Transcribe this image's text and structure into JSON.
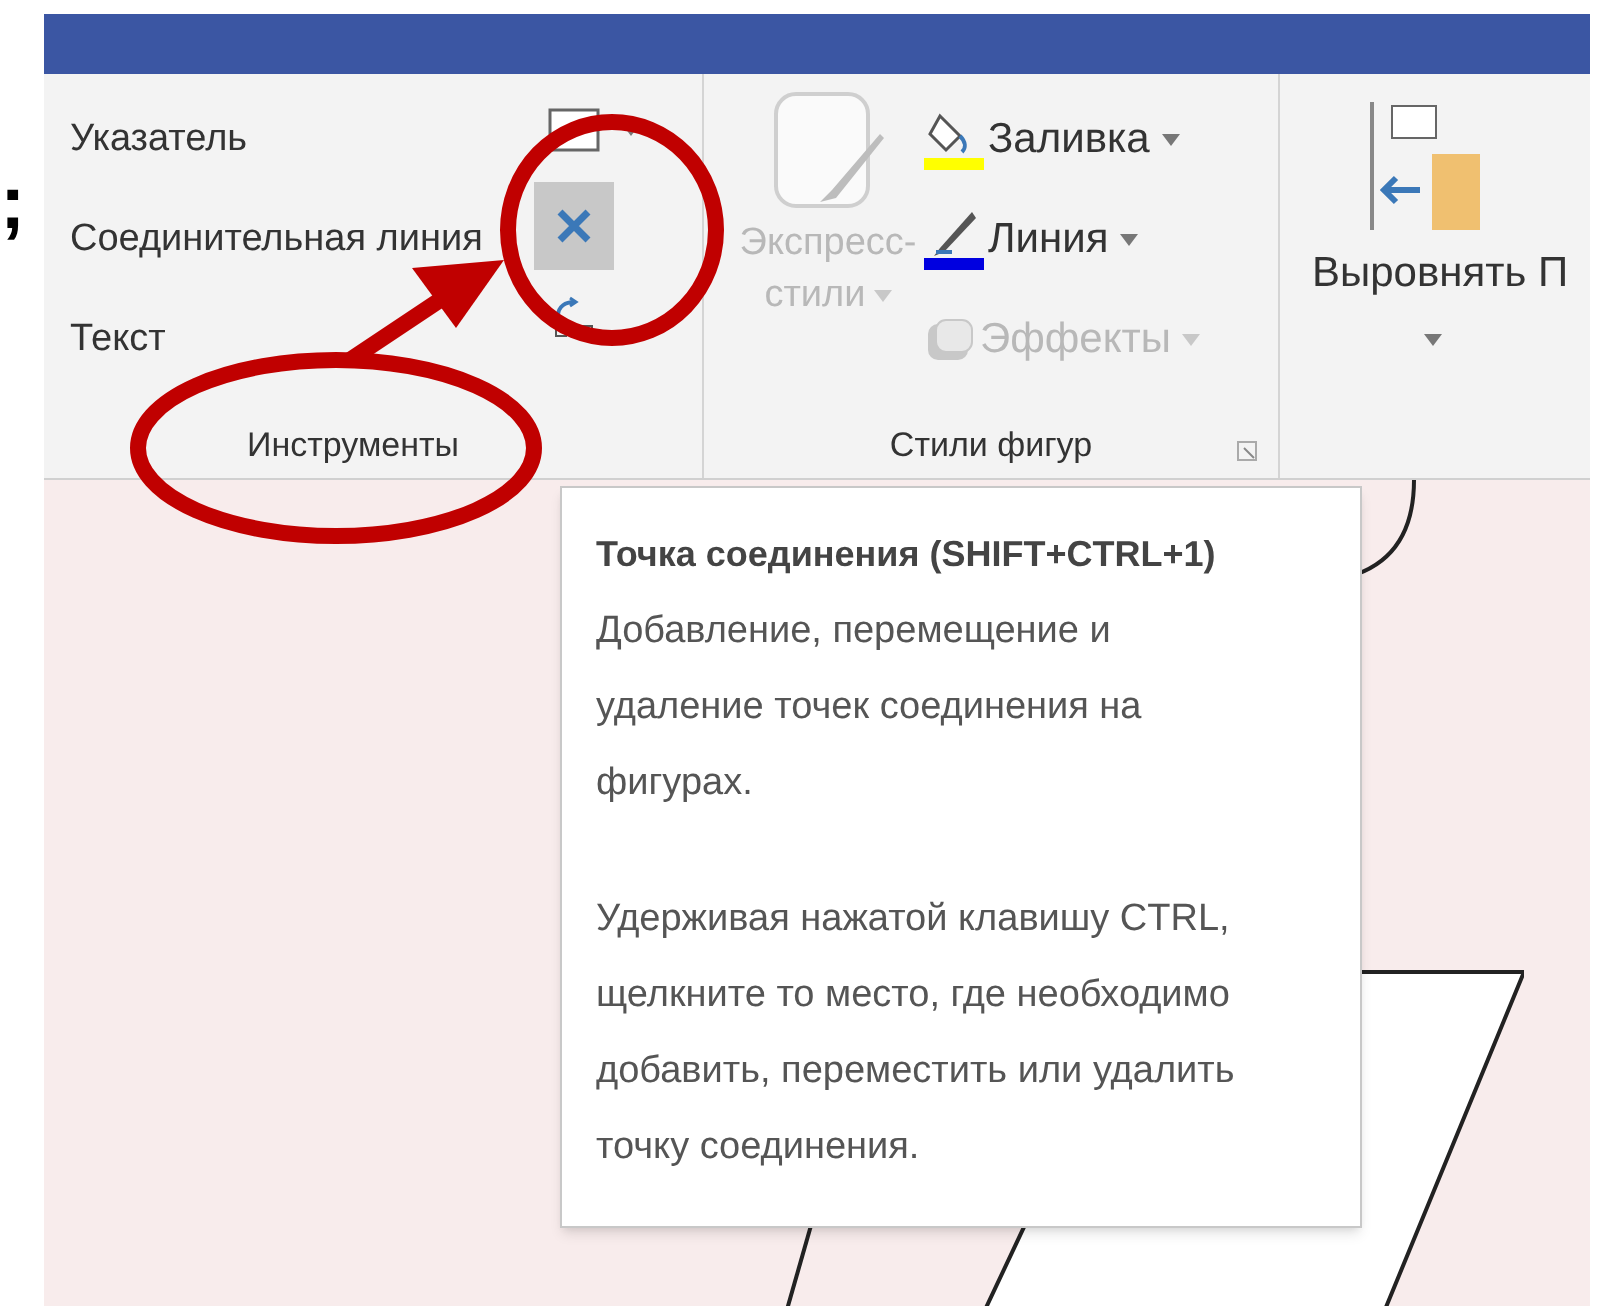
{
  "side_mark": ";",
  "ribbon": {
    "groups": [
      {
        "kind": "tools",
        "label": "Инструменты",
        "items": [
          {
            "label": "Указатель"
          },
          {
            "label": "Соединительная линия"
          },
          {
            "label": "Текст"
          }
        ],
        "tool_buttons": [
          {
            "kind": "rectangle",
            "selected": false
          },
          {
            "kind": "connection-point",
            "selected": true
          },
          {
            "kind": "connector",
            "selected": false
          }
        ]
      },
      {
        "kind": "styles",
        "label": "Стили фигур",
        "big_button": {
          "label_lines": [
            "Экспресс-",
            "стили"
          ],
          "disabled": true
        },
        "items": [
          {
            "kind": "fill",
            "label": "Заливка",
            "disabled": false
          },
          {
            "kind": "line",
            "label": "Линия",
            "disabled": false
          },
          {
            "kind": "effects",
            "label": "Эффекты",
            "disabled": true
          }
        ]
      },
      {
        "kind": "align",
        "label": "Выровнять П"
      }
    ]
  },
  "tooltip": {
    "title": "Точка соединения (SHIFT+CTRL+1)",
    "paragraphs": [
      [
        "Добавление, перемещение и",
        "удаление точек соединения на",
        "фигурах."
      ],
      [
        "Удерживая нажатой клавишу CTRL,",
        "щелкните то место, где необходимо",
        "добавить, переместить или удалить",
        "точку соединения."
      ]
    ]
  }
}
